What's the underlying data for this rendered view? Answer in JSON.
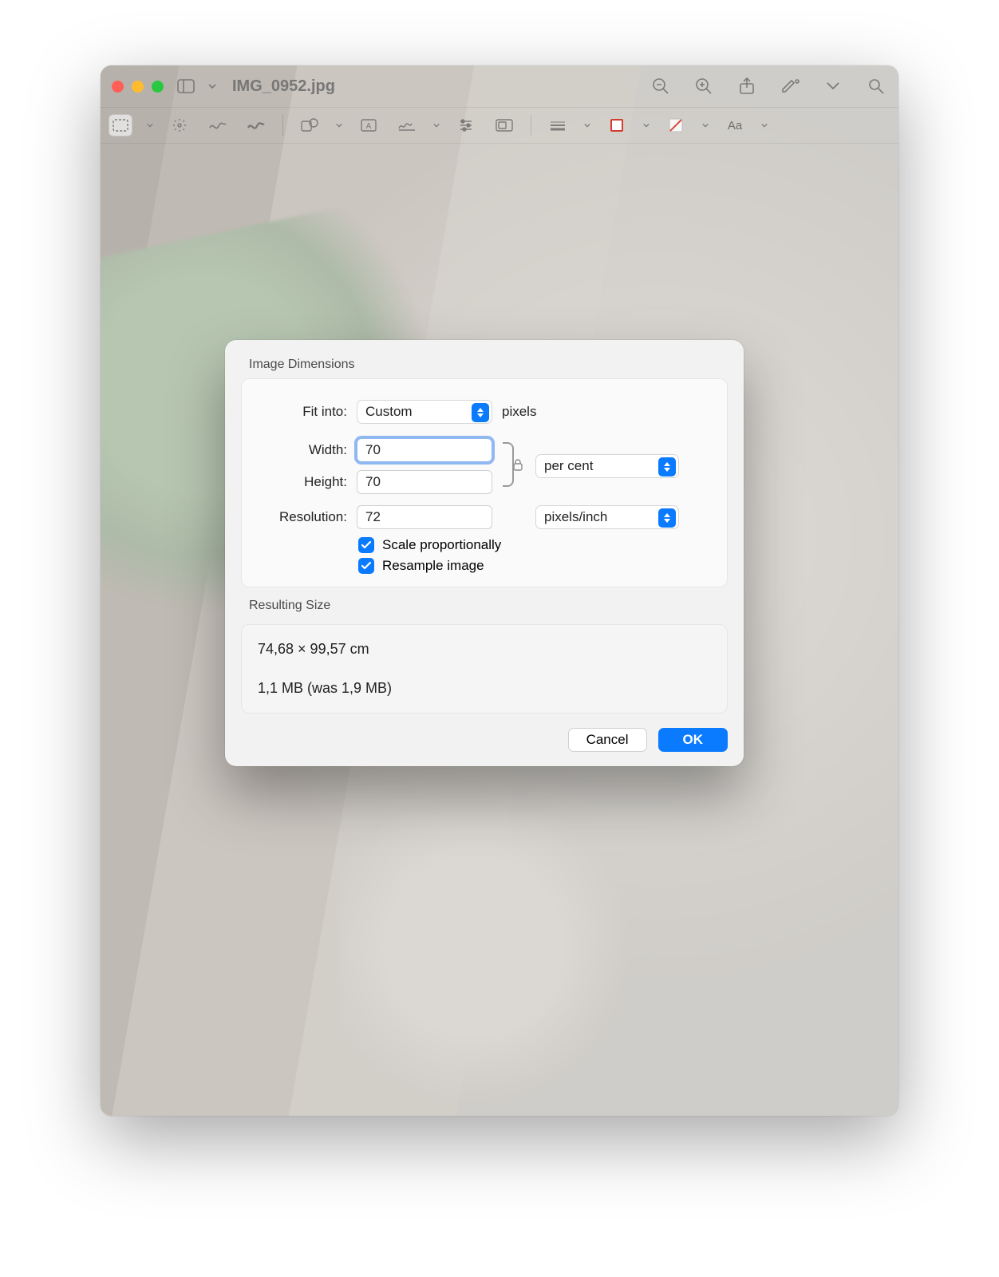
{
  "window": {
    "title": "IMG_0952.jpg"
  },
  "dialog": {
    "section_label": "Image Dimensions",
    "fit_into_label": "Fit into:",
    "fit_into_value": "Custom",
    "fit_into_units": "pixels",
    "width_label": "Width:",
    "width_value": "70",
    "height_label": "Height:",
    "height_value": "70",
    "size_units": "per cent",
    "resolution_label": "Resolution:",
    "resolution_value": "72",
    "resolution_units": "pixels/inch",
    "scale_checkbox_label": "Scale proportionally",
    "resample_checkbox_label": "Resample image",
    "resulting_label": "Resulting Size",
    "resulting_dims": "74,68 × 99,57 cm",
    "resulting_size": "1,1 MB (was 1,9 MB)",
    "cancel": "Cancel",
    "ok": "OK"
  }
}
